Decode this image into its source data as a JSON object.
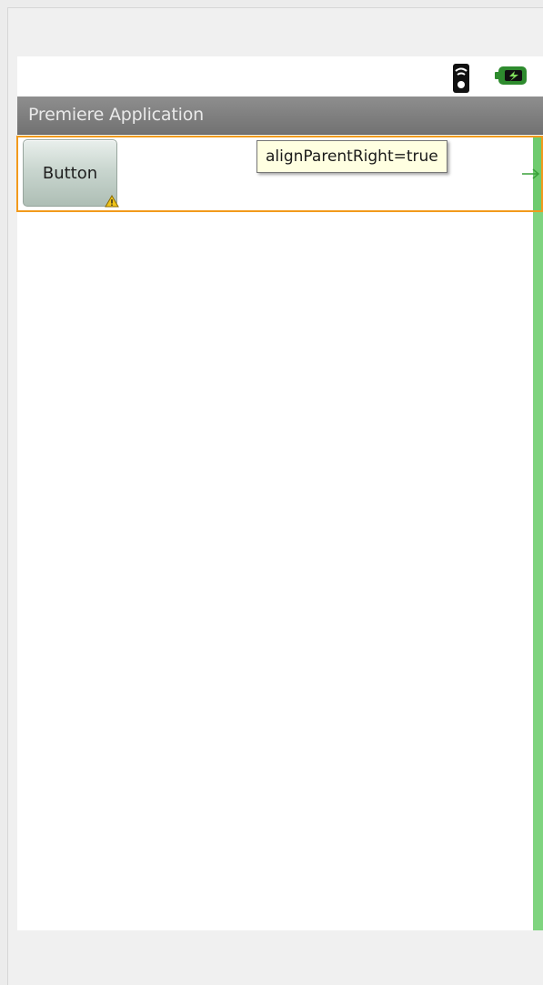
{
  "status_bar": {
    "icons": [
      "wifi-signal-icon",
      "battery-charging-icon"
    ]
  },
  "title_bar": {
    "title": "Premiere Application"
  },
  "layout": {
    "button_label": "Button",
    "tooltip": "alignParentRight=true",
    "warning_icon": "warning-icon",
    "anchor_icon": "right-anchor-arrow-icon"
  },
  "colors": {
    "selection_border": "#f29a1c",
    "guide_green": "#7fd47f",
    "title_bar_bg": "#7f7f7f",
    "tooltip_bg": "#ffffe1"
  }
}
